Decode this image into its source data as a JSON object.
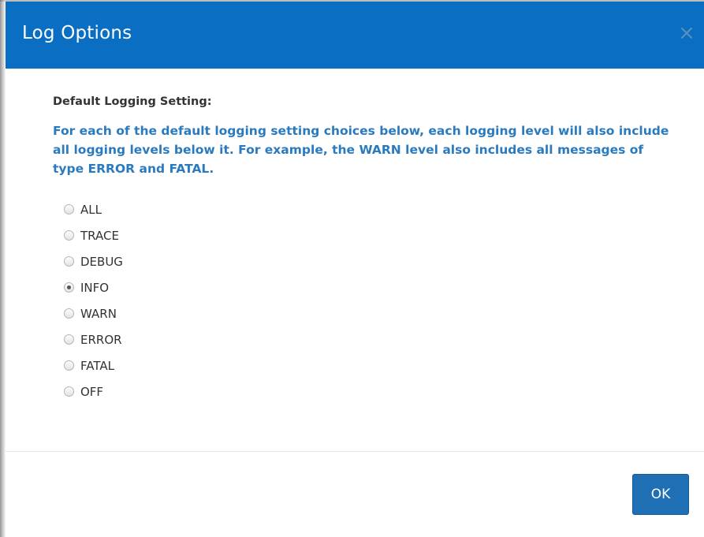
{
  "dialog": {
    "title": "Log Options",
    "close_label": "×"
  },
  "body": {
    "section_label": "Default Logging Setting:",
    "help_text": "For each of the default logging setting choices below, each logging level will also include all logging levels below it. For example, the WARN level also includes all messages of type ERROR and FATAL.",
    "options": [
      {
        "label": "ALL",
        "checked": false
      },
      {
        "label": "TRACE",
        "checked": false
      },
      {
        "label": "DEBUG",
        "checked": false
      },
      {
        "label": "INFO",
        "checked": true
      },
      {
        "label": "WARN",
        "checked": false
      },
      {
        "label": "ERROR",
        "checked": false
      },
      {
        "label": "FATAL",
        "checked": false
      },
      {
        "label": "OFF",
        "checked": false
      }
    ]
  },
  "footer": {
    "ok_label": "OK"
  },
  "colors": {
    "header": "#0a6fc2",
    "help_text": "#2a7abf",
    "ok_button": "#1f6fb5"
  }
}
